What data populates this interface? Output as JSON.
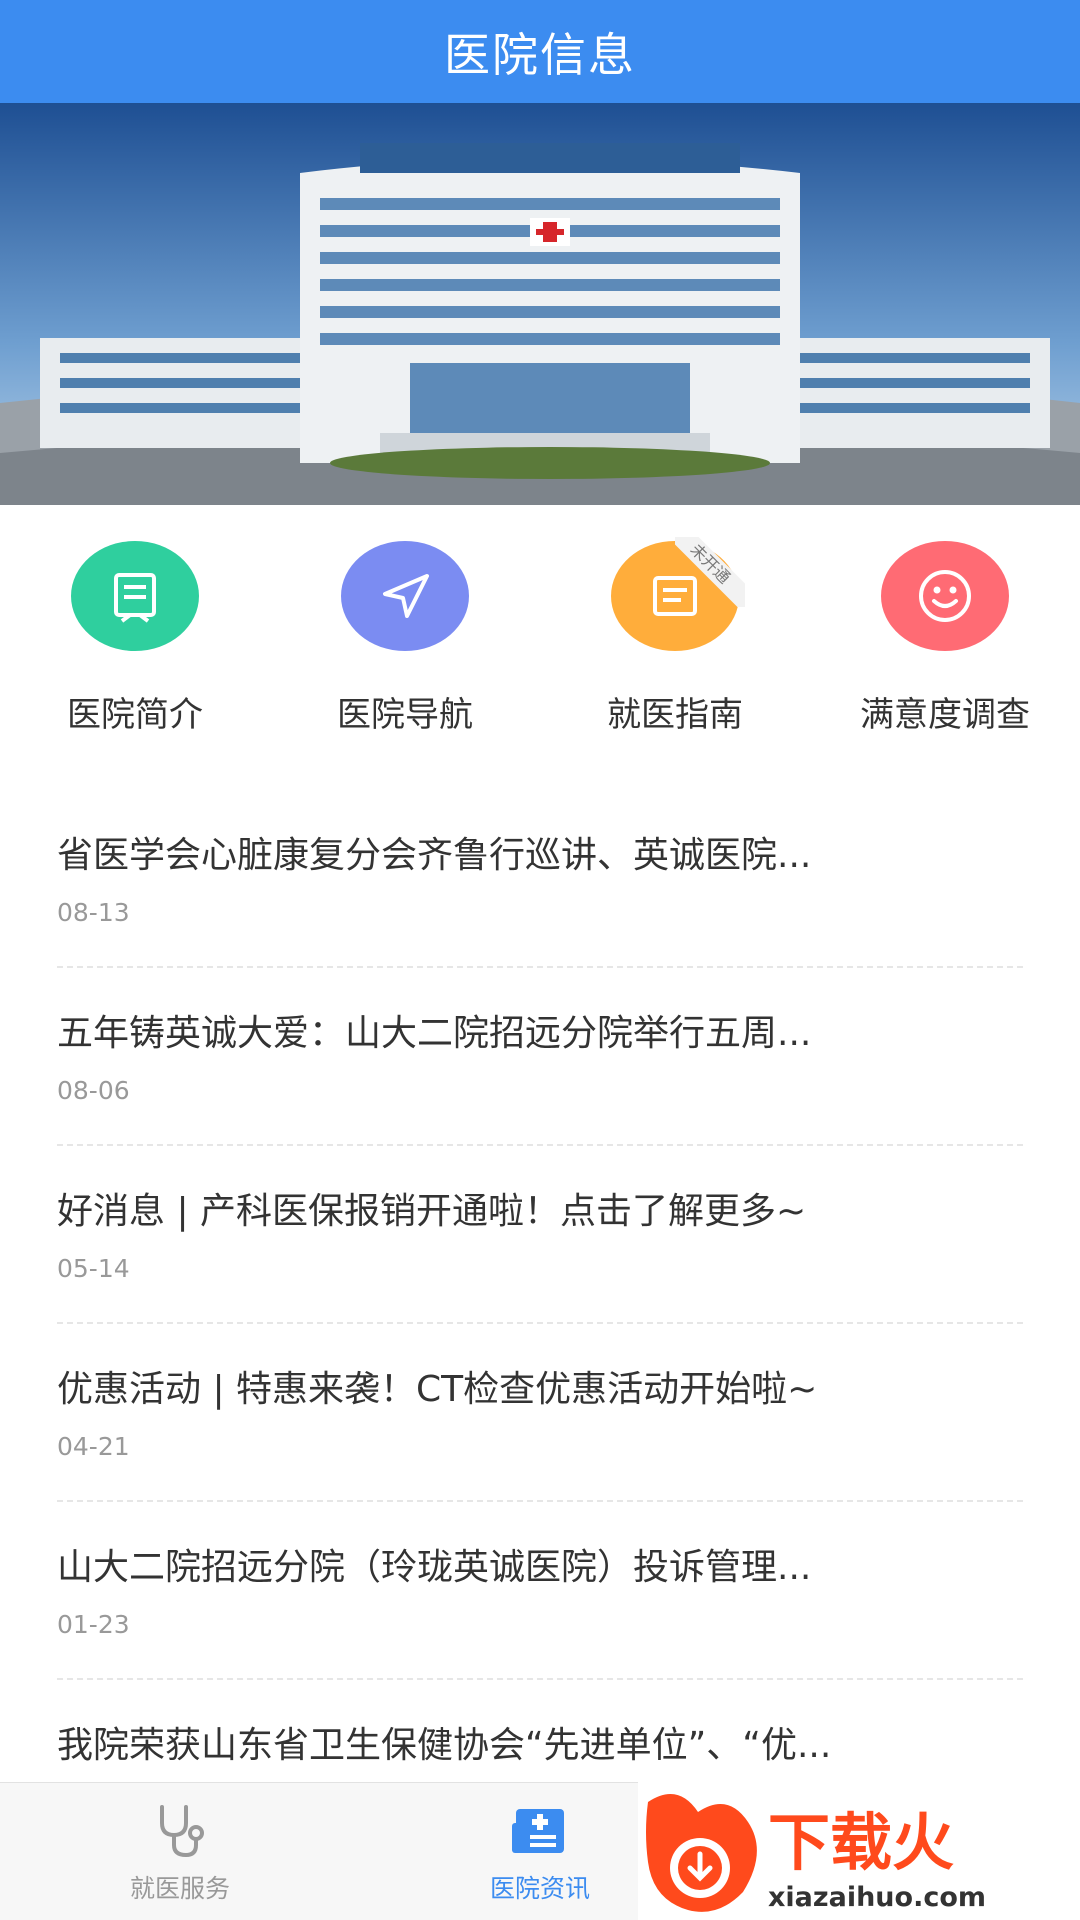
{
  "header": {
    "title": "医院信息"
  },
  "quick_links": [
    {
      "label": "医院简介",
      "icon": "document-icon",
      "color": "#2fcf9e"
    },
    {
      "label": "医院导航",
      "icon": "navigation-arrow-icon",
      "color": "#7b8cf2"
    },
    {
      "label": "就医指南",
      "icon": "guide-list-icon",
      "color": "#ffad3b",
      "ribbon": "未开通"
    },
    {
      "label": "满意度调查",
      "icon": "smiley-face-icon",
      "color": "#ff6b74"
    }
  ],
  "news": [
    {
      "title": "省医学会心脏康复分会齐鲁行巡讲、英诚医院...",
      "date": "08-13"
    },
    {
      "title": "五年铸英诚大爱：山大二院招远分院举行五周...",
      "date": "08-06"
    },
    {
      "title": "好消息 | 产科医保报销开通啦！点击了解更多~",
      "date": "05-14"
    },
    {
      "title": "优惠活动 | 特惠来袭！CT检查优惠活动开始啦~",
      "date": "04-21"
    },
    {
      "title": "山大二院招远分院（玲珑英诚医院）投诉管理...",
      "date": "01-23"
    },
    {
      "title": "我院荣获山东省卫生保健协会“先进单位”、“优...",
      "date": ""
    }
  ],
  "tabbar": {
    "tabs": [
      {
        "label": "就医服务",
        "icon": "stethoscope-icon",
        "active": false
      },
      {
        "label": "医院资讯",
        "icon": "hospital-news-icon",
        "active": true
      }
    ],
    "active_color": "#3c8cf0",
    "inactive_color": "#999999"
  },
  "watermark": {
    "brand": "下载火",
    "url": "xiazaihuo.com"
  }
}
